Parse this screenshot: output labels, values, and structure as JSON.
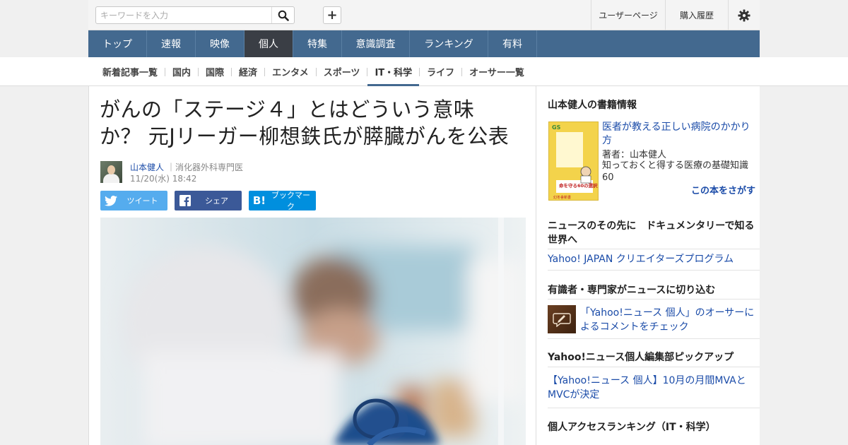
{
  "header": {
    "search_placeholder": "キーワードを入力",
    "icons": {
      "search": "search-icon",
      "add": "plus-icon",
      "settings": "gear-icon"
    },
    "user_page": "ユーザーページ",
    "purchase_history": "購入履歴"
  },
  "global_nav": [
    "トップ",
    "速報",
    "映像",
    "個人",
    "特集",
    "意識調査",
    "ランキング",
    "有料"
  ],
  "global_nav_active": "個人",
  "sub_nav": [
    "新着記事一覧",
    "国内",
    "国際",
    "経済",
    "エンタメ",
    "スポーツ",
    "IT・科学",
    "ライフ",
    "オーサー一覧"
  ],
  "sub_nav_active": "IT・科学",
  "colors": {
    "nav_bg": "#43698f",
    "nav_active": "#3a3e45",
    "link": "#1a4ba8",
    "twitter": "#55acee",
    "facebook": "#3b5998",
    "hatena": "#008fde"
  },
  "article": {
    "title_line1": "がんの「ステージ４」とはどういう意味",
    "title_line2": "か？ 元Jリーガー柳想鉄氏が膵臓がんを公表",
    "author_name": "山本健人",
    "author_role": "消化器外科専門医",
    "date": "11/20(水) 18:42",
    "share": {
      "tweet": "ツイート",
      "facebook": "シェア",
      "bookmark": "ブックマーク",
      "hatena_mark": "B!"
    }
  },
  "sidebar": {
    "book_section_title": "山本健人の書籍情報",
    "book_title": "医者が教える正しい病院のかかり方",
    "book_author": "著者：山本健人",
    "book_desc": "知っておくと得する医療の基礎知識60",
    "book_find": "この本をさがす",
    "book_cover": {
      "spine_text": "医者が教える正しい病院のかかり方",
      "band_text": "命を守る60の選択",
      "series": "幻冬舎新書"
    },
    "doc_title": "ニュースのその先に　ドキュメンタリーで知る世界へ",
    "doc_link": "Yahoo! JAPAN クリエイターズプログラム",
    "expert_title": "有識者・専門家がニュースに切り込む",
    "expert_link": "「Yahoo!ニュース 個人」のオーサーによるコメントをチェック",
    "pickup_title": "Yahoo!ニュース個人編集部ピックアップ",
    "pickup_link": "【Yahoo!ニュース 個人】10月の月間MVAとMVCが決定",
    "ranking_title": "個人アクセスランキング（IT・科学）"
  }
}
